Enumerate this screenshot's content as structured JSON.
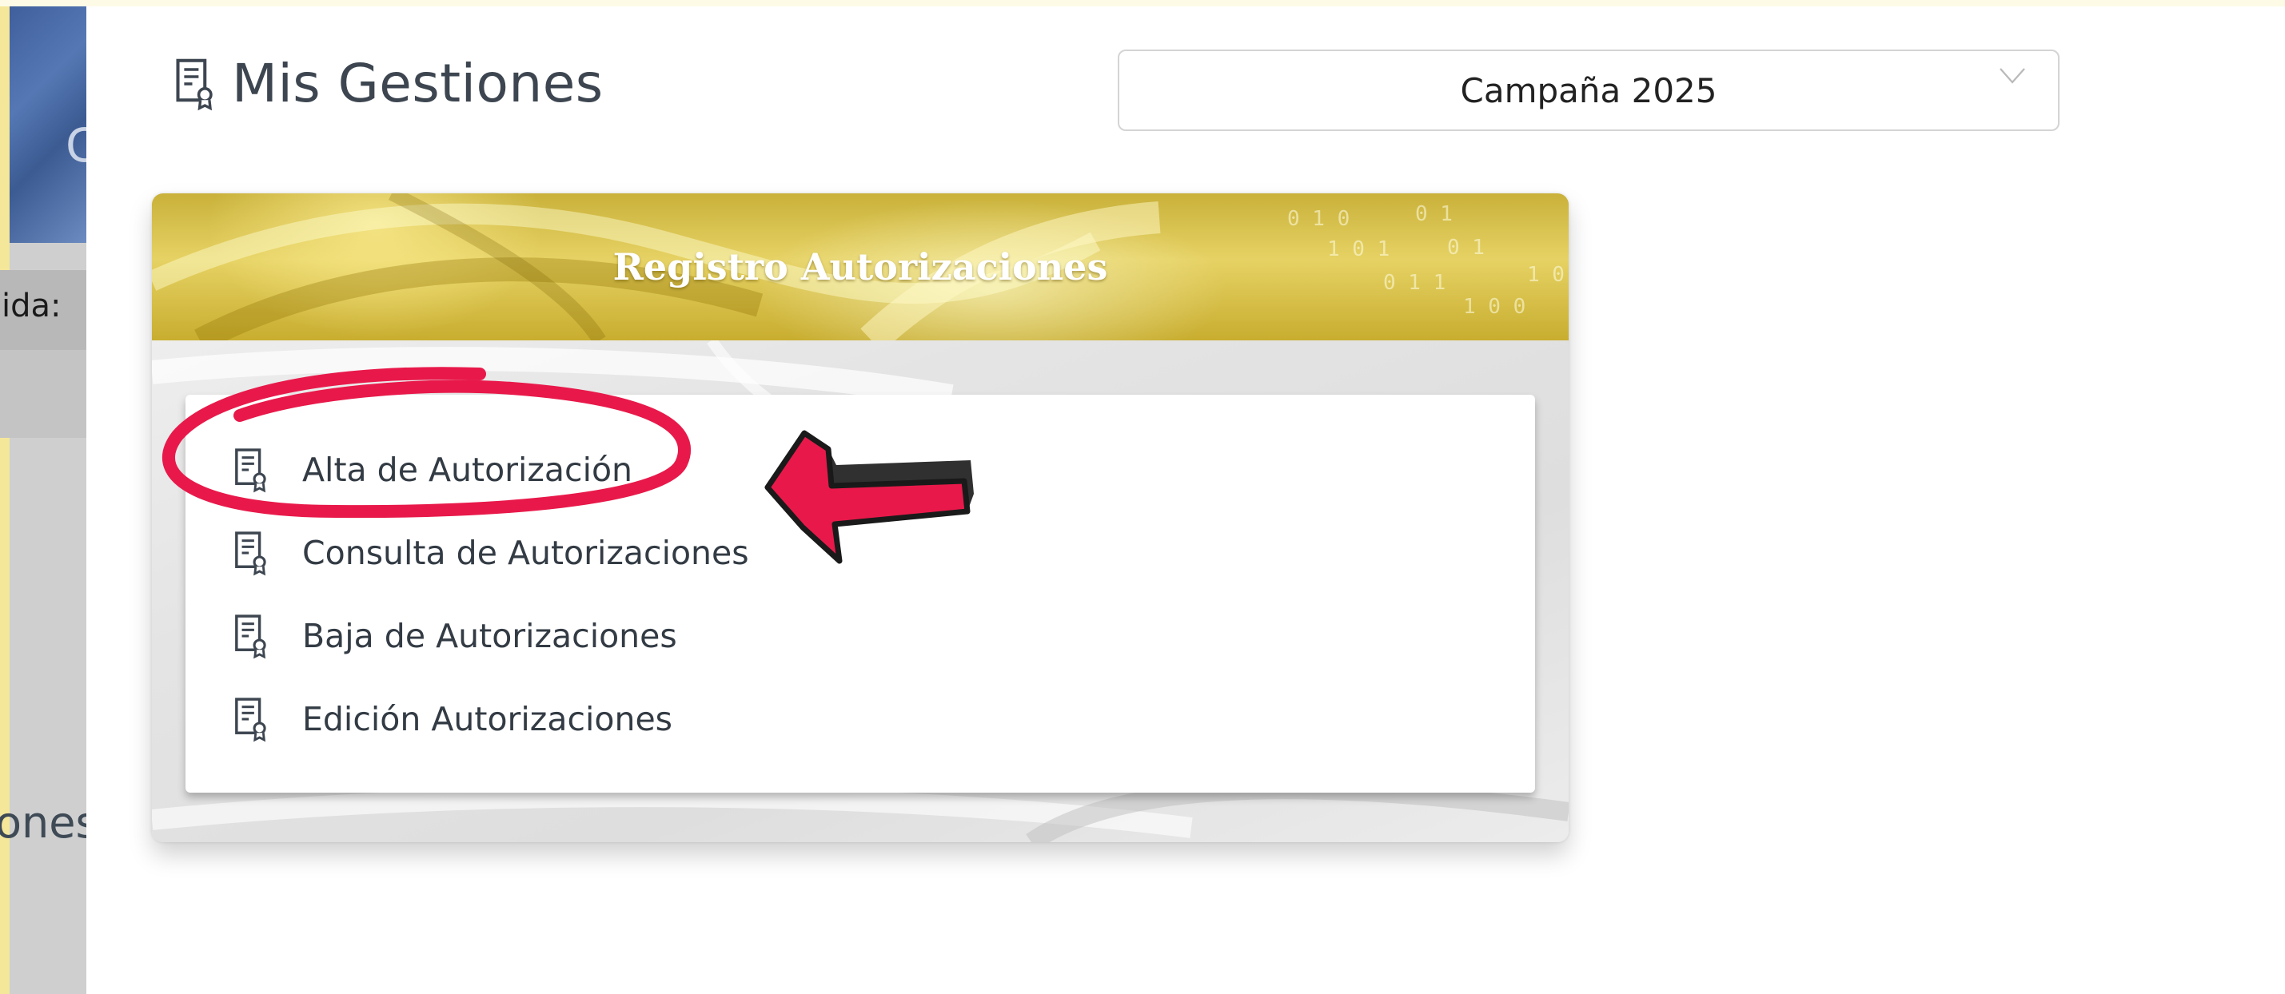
{
  "background_app": {
    "partial_label_1": "ida:",
    "partial_label_2": "ones",
    "partial_letter": "C"
  },
  "header": {
    "title": "Mis Gestiones",
    "icon": "certificate-document-icon"
  },
  "campaign_select": {
    "value": "Campaña 2025",
    "icon": "chevron-down-icon"
  },
  "card": {
    "title": "Registro Autorizaciones",
    "items": [
      {
        "label": "Alta de Autorización",
        "icon": "certificate-document-icon",
        "highlighted": true
      },
      {
        "label": "Consulta de Autorizaciones",
        "icon": "certificate-document-icon"
      },
      {
        "label": "Baja de Autorizaciones",
        "icon": "certificate-document-icon"
      },
      {
        "label": "Edición Autorizaciones",
        "icon": "certificate-document-icon"
      }
    ]
  },
  "colors": {
    "highlight_annotation": "#e8194a",
    "card_header_gold": "#d8c24a",
    "text_dark": "#333b44"
  }
}
